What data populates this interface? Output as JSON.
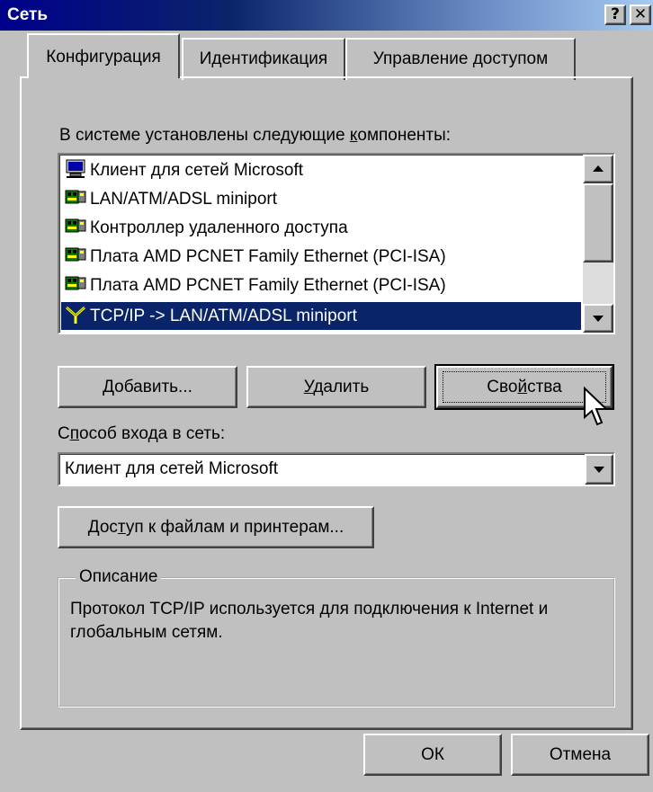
{
  "window": {
    "title": "Сеть",
    "help_button": "?",
    "close_button": "✕"
  },
  "tabs": [
    {
      "label": "Конфигурация",
      "active": true
    },
    {
      "label": "Идентификация",
      "active": false
    },
    {
      "label": "Управление доступом",
      "active": false
    }
  ],
  "components": {
    "label_prefix": "В системе установлены следующие ",
    "label_ul": "к",
    "label_suffix": "омпоненты:",
    "items": [
      {
        "label": "Клиент для сетей Microsoft",
        "icon": "network-client-icon",
        "selected": false
      },
      {
        "label": "LAN/ATM/ADSL miniport",
        "icon": "network-adapter-icon",
        "selected": false
      },
      {
        "label": "Контроллер удаленного доступа",
        "icon": "network-adapter-icon",
        "selected": false
      },
      {
        "label": "Плата AMD PCNET Family Ethernet (PCI-ISA)",
        "icon": "network-adapter-icon",
        "selected": false
      },
      {
        "label": "Плата AMD PCNET Family Ethernet (PCI-ISA)",
        "icon": "network-adapter-icon",
        "selected": false
      },
      {
        "label": "TCP/IP -> LAN/ATM/ADSL miniport",
        "icon": "protocol-icon",
        "selected": true
      }
    ]
  },
  "buttons": {
    "add_ul": "Д",
    "add_rest": "обавить...",
    "remove_ul": "У",
    "remove_rest": "далить",
    "props_a": "Сво",
    "props_ul": "й",
    "props_b": "ства",
    "file_share_a": "Дос",
    "file_share_ul": "т",
    "file_share_b": "уп к файлам и принтерам...",
    "ok": "ОК",
    "cancel": "Отмена"
  },
  "logon": {
    "label_a": "С",
    "label_ul": "п",
    "label_b": "особ входа в сеть:",
    "selected": "Клиент для сетей Microsoft"
  },
  "description": {
    "title": "Описание",
    "text": "Протокол TCP/IP используется для подключения к Internet и глобальным сетям."
  },
  "colors": {
    "titlebar_start": "#00008a",
    "titlebar_end": "#a6caf0",
    "selection": "#0a246a",
    "face": "#c0c0c0"
  }
}
